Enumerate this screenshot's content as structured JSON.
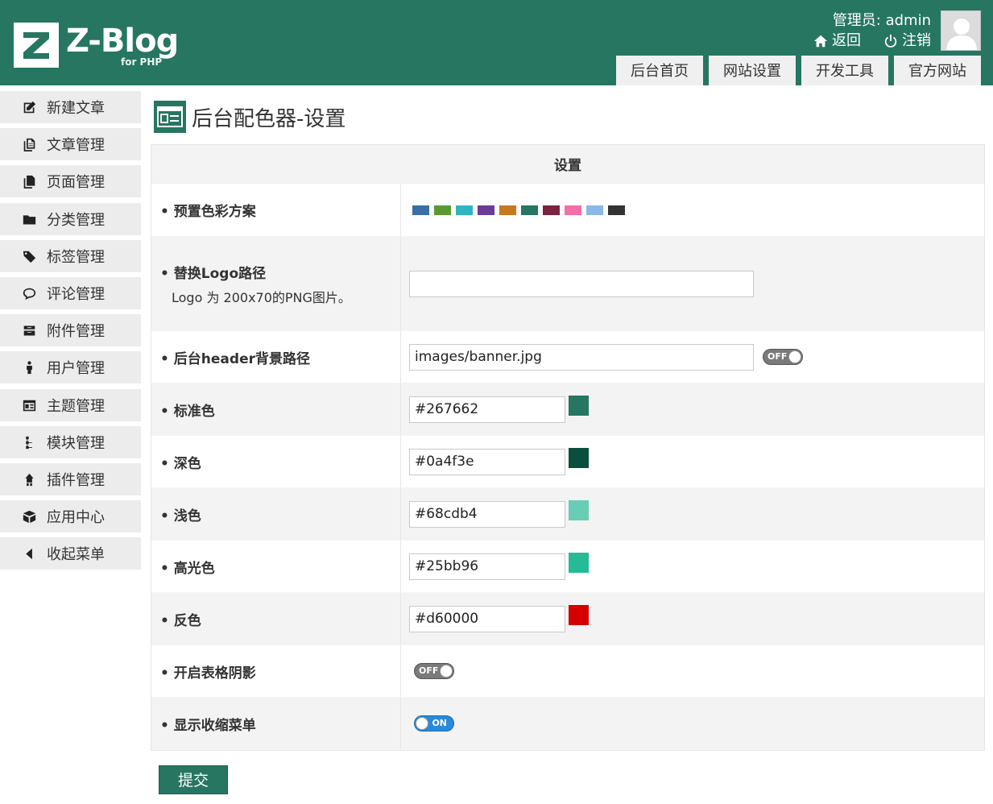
{
  "header": {
    "logo_letter": "Z",
    "logo_title": "Z-Blog",
    "logo_sub": "for PHP",
    "user_label": "管理员: admin",
    "back_label": "返回",
    "logout_label": "注销",
    "nav": [
      "后台首页",
      "网站设置",
      "开发工具",
      "官方网站"
    ]
  },
  "sidebar": {
    "items": [
      {
        "label": "新建文章",
        "icon": "edit-icon"
      },
      {
        "label": "文章管理",
        "icon": "articles-icon"
      },
      {
        "label": "页面管理",
        "icon": "pages-icon"
      },
      {
        "label": "分类管理",
        "icon": "folder-icon"
      },
      {
        "label": "标签管理",
        "icon": "tag-icon"
      },
      {
        "label": "评论管理",
        "icon": "comment-icon"
      },
      {
        "label": "附件管理",
        "icon": "attachment-icon"
      },
      {
        "label": "用户管理",
        "icon": "user-icon"
      },
      {
        "label": "主题管理",
        "icon": "theme-icon"
      },
      {
        "label": "模块管理",
        "icon": "module-icon"
      },
      {
        "label": "插件管理",
        "icon": "plugin-icon"
      },
      {
        "label": "应用中心",
        "icon": "app-center-icon"
      },
      {
        "label": "收起菜单",
        "icon": "collapse-icon"
      }
    ]
  },
  "page": {
    "title": "后台配色器-设置"
  },
  "settings": {
    "head": "设置",
    "preset_label": "预置色彩方案",
    "preset_colors": [
      "#3a6ea5",
      "#5a9a33",
      "#2fb5c2",
      "#6a3c96",
      "#c47a1f",
      "#267662",
      "#7a2440",
      "#f36fa6",
      "#8ab8e6",
      "#333333"
    ],
    "logo_label": "替换Logo路径",
    "logo_note": "Logo 为 200x70的PNG图片。",
    "logo_value": "",
    "header_bg_label": "后台header背景路径",
    "header_bg_value": "images/banner.jpg",
    "header_bg_toggle": "OFF",
    "standard_label": "标准色",
    "standard_value": "#267662",
    "dark_label": "深色",
    "dark_value": "#0a4f3e",
    "light_label": "浅色",
    "light_value": "#68cdb4",
    "highlight_label": "高光色",
    "highlight_value": "#25bb96",
    "inverse_label": "反色",
    "inverse_value": "#d60000",
    "shadow_label": "开启表格阴影",
    "shadow_toggle": "OFF",
    "collapse_label": "显示收缩菜单",
    "collapse_toggle": "ON"
  },
  "submit_label": "提交"
}
